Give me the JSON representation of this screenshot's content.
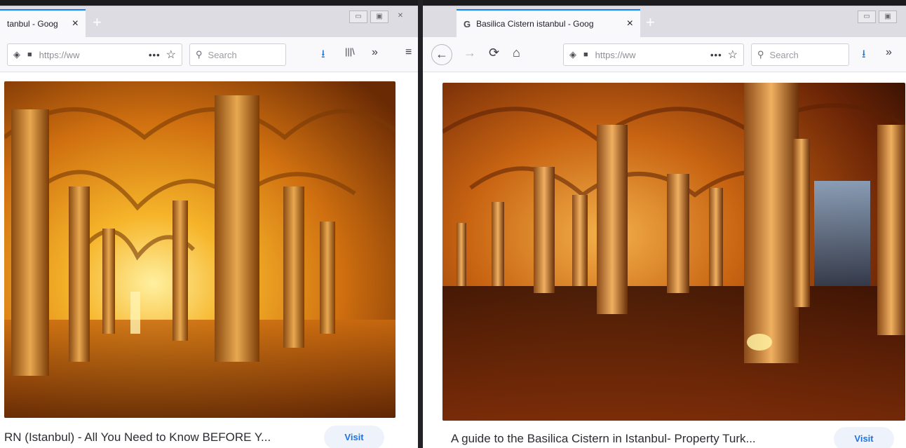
{
  "left": {
    "tab_title": "tanbul - Goog",
    "url": "https://ww",
    "search_placeholder": "Search",
    "caption": "RN (Istanbul) - All You Need to Know BEFORE Y...",
    "visit": "Visit"
  },
  "right": {
    "favicon": "G",
    "tab_title": "Basilica Cistern istanbul - Goog",
    "url": "https://ww",
    "search_placeholder": "Search",
    "caption": "A guide to the Basilica Cistern in Istanbul- Property Turk...",
    "visit": "Visit"
  },
  "icons": {
    "close": "×",
    "newtab": "+",
    "back": "←",
    "forward": "→",
    "reload": "⟳",
    "home": "⌂",
    "shield": "◈",
    "lock": "🔒",
    "more": "•••",
    "star": "☆",
    "search": "⚲",
    "download": "⭳",
    "library": "|||\\",
    "overflow": "»",
    "menu": "≡"
  },
  "colors": {
    "accent": "#0a84ff",
    "visit_text": "#1a73e8",
    "photo_warm": "#e07a10"
  }
}
